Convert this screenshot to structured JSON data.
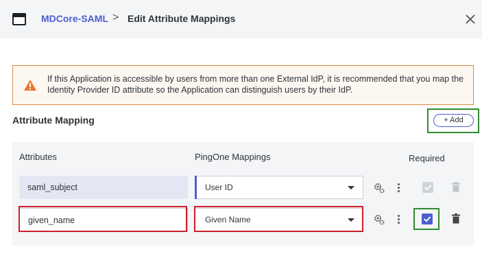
{
  "header": {
    "app_name": "MDCore-SAML",
    "separator": ">",
    "page_title": "Edit Attribute Mappings"
  },
  "warning": {
    "text": "If this Application is accessible by users from more than one External IdP, it is recommended that you map the Identity Provider ID attribute so the Application can distinguish users by their IdP."
  },
  "section": {
    "title": "Attribute Mapping",
    "add_label": "+ Add"
  },
  "table": {
    "headers": {
      "attributes": "Attributes",
      "mappings": "PingOne Mappings",
      "required": "Required"
    },
    "rows": [
      {
        "attribute": "saml_subject",
        "mapping": "User ID",
        "required": true,
        "required_locked": true
      },
      {
        "attribute": "given_name",
        "mapping": "Given Name",
        "required": true,
        "required_locked": false
      }
    ]
  },
  "colors": {
    "accent": "#4c5ecf",
    "warning_border": "#d98a3c",
    "highlight_red": "#cc1f2b",
    "highlight_green": "#2e8b2e"
  }
}
